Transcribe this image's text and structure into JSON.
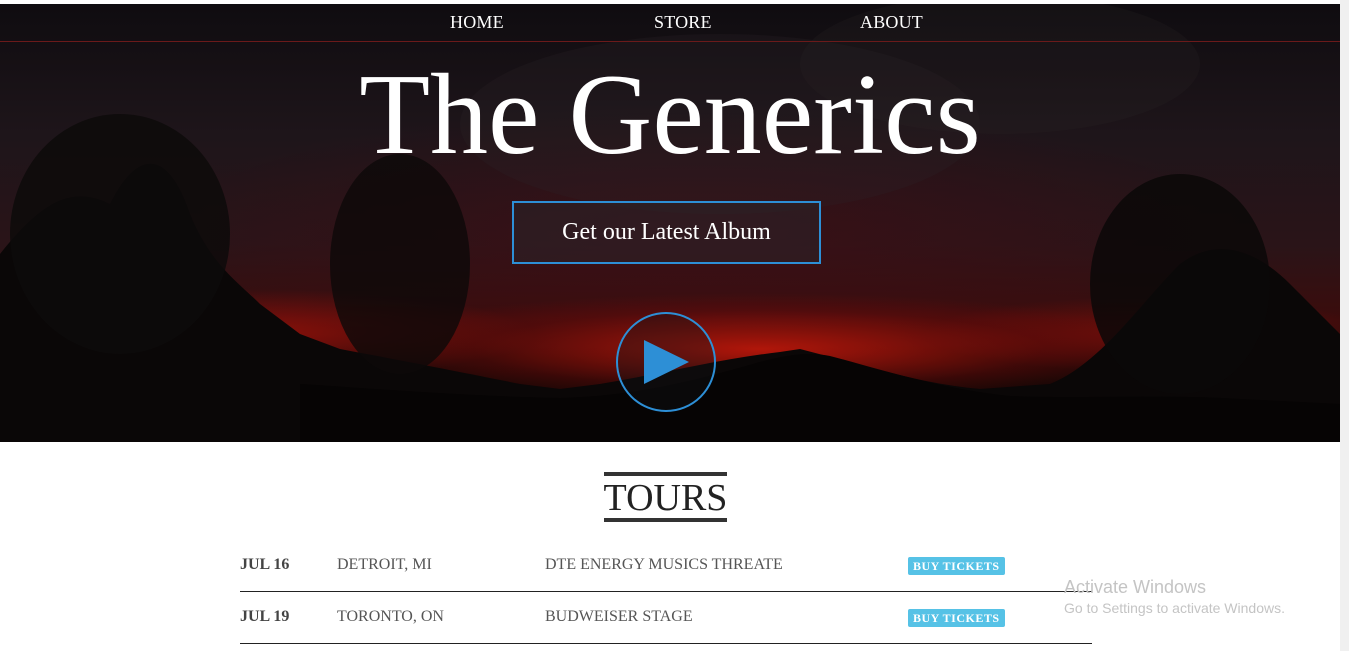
{
  "nav": {
    "home": "HOME",
    "store": "STORE",
    "about": "ABOUT"
  },
  "hero": {
    "title": "The Generics",
    "album_button": "Get our Latest Album",
    "play_icon": "play-icon"
  },
  "tours": {
    "heading": "TOURS",
    "rows": [
      {
        "date": "JUL 16",
        "city": "DETROIT, MI",
        "venue": "DTE ENERGY MUSICS THREATE",
        "button": "BUY TICKETS"
      },
      {
        "date": "JUL 19",
        "city": "TORONTO, ON",
        "venue": "BUDWEISER STAGE",
        "button": "BUY TICKETS"
      }
    ]
  },
  "watermark": {
    "line1": "Activate Windows",
    "line2": "Go to Settings to activate Windows."
  },
  "colors": {
    "accent": "#2d8fd6",
    "ticket_button": "#56c2e6"
  }
}
